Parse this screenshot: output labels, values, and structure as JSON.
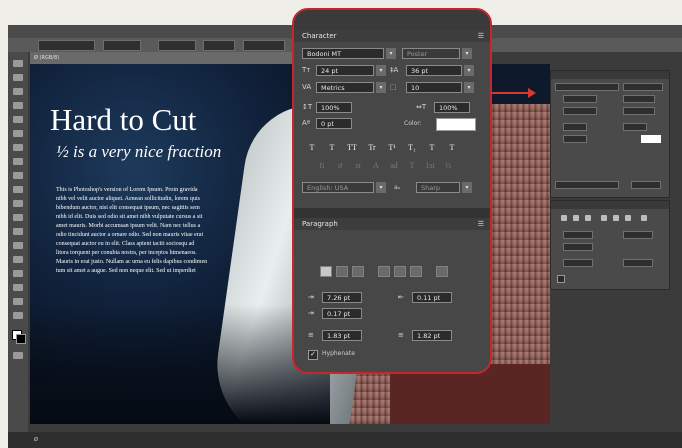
{
  "document": {
    "tab_label": "Ø (RGB/8)",
    "title": "Hard to Cut",
    "subtitle": "½ is a very nice fraction",
    "body_lines": [
      "This is Photoshop's version of Lorem Ipsum. Proin gravida",
      "nibh vel velit auctor aliquet. Aenean sollicitudin, lorem quis",
      "bibendum auctor, nisi elit consequat ipsum, nec sagittis sem",
      "nibh id elit. Duis sed odio sit amet nibh vulputate cursus a sit",
      "amet mauris. Morbi accumsan ipsum velit. Nam nec tellus a",
      "odio tincidunt auctor a ornare odio. Sed non mauris vitae erat",
      "consequat auctor eu in elit. Class aptent taciti sociosqu ad",
      "litora torquent per conubia nostra, per inceptos himenaeos.",
      "Mauris in erat justo. Nullam ac urna eu felis dapibus condimen",
      "tum sit amet a augue. Sed non neque elit. Sed ut imperdiet"
    ]
  },
  "statusbar": {
    "text": "Ø"
  },
  "character_panel": {
    "title": "Character",
    "font_family": "Bodoni MT",
    "font_style": "Poster",
    "font_size": "24 pt",
    "leading": "36 pt",
    "kerning": "Metrics",
    "tracking": "10",
    "vertical_scale": "100%",
    "horizontal_scale": "100%",
    "baseline_shift": "0 pt",
    "color_label": "Color:",
    "color": "#ffffff",
    "type_buttons": [
      "T",
      "T",
      "TT",
      "Tr",
      "T¹",
      "T₁",
      "T",
      "T"
    ],
    "opentype_buttons": [
      "fi",
      "ơ",
      "st",
      "A",
      "ad",
      "T",
      "1st",
      "½"
    ],
    "language": "English: USA",
    "aa_label": "aₐ",
    "antialias": "Sharp"
  },
  "paragraph_panel": {
    "title": "Paragraph",
    "indent_left": "7.26 pt",
    "indent_right": "0.11 pt",
    "indent_first": "0.17 pt",
    "space_before": "1.83 pt",
    "space_after": "1.82 pt",
    "hyphenate_label": "Hyphenate",
    "hyphenate": true
  },
  "colors": {
    "callout_border": "#c8262c",
    "arrow": "#d63a2f"
  }
}
